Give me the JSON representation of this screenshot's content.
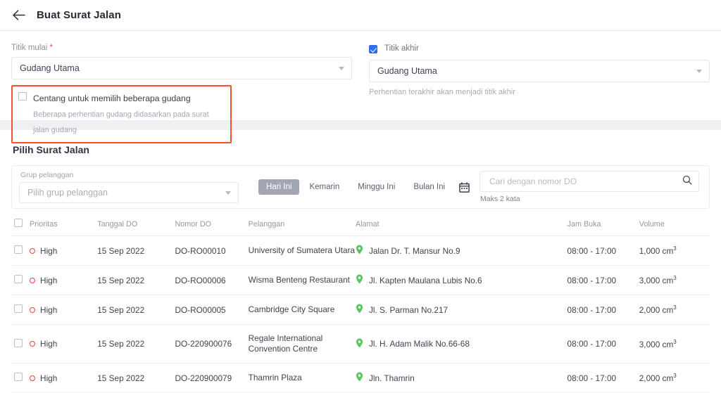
{
  "header": {
    "back_icon": "arrow-left-icon",
    "title": "Buat Surat Jalan"
  },
  "form": {
    "start_point": {
      "label": "Titik mulai",
      "required_mark": "*",
      "value": "Gudang Utama"
    },
    "multi_warehouse": {
      "checked": false,
      "title": "Centang untuk memilih beberapa gudang",
      "subtitle": "Beberapa perhentian gudang didasarkan pada surat jalan gudang",
      "highlight_color": "#f4522d"
    },
    "end_point": {
      "checkbox_checked": true,
      "checkbox_color": "#2f6fed",
      "label": "Titik akhir",
      "value": "Gudang Utama",
      "hint": "Perhentian terakhir akan menjadi titik akhir"
    }
  },
  "main": {
    "section_title": "Pilih Surat Jalan",
    "filters": {
      "customer_group": {
        "label": "Grup pelanggan",
        "placeholder": "Pilih grup pelanggan"
      },
      "ranges": [
        {
          "label": "Hari Ini",
          "active": true
        },
        {
          "label": "Kemarin",
          "active": false
        },
        {
          "label": "Minggu Ini",
          "active": false
        },
        {
          "label": "Bulan Ini",
          "active": false
        }
      ],
      "calendar_icon": "calendar-icon",
      "active_pill_color": "#a2a6b4",
      "search": {
        "placeholder": "Cari dengan nomor DO",
        "value": "",
        "icon": "search-icon",
        "hint": "Maks 2 kata"
      }
    },
    "table": {
      "columns": [
        "",
        "Prioritas",
        "Tanggal DO",
        "Nomor DO",
        "Pelanggan",
        "Alamat",
        "Jam Buka",
        "Volume"
      ],
      "priority_color": "#ed3f3f",
      "pin_color": "#5cc45f",
      "rows": [
        {
          "selected": false,
          "priority": "High",
          "date": "15 Sep 2022",
          "do_number": "DO-RO00010",
          "customer": "University of Sumatera Utara",
          "address": "Jalan Dr. T. Mansur No.9",
          "hours": "08:00 - 17:00",
          "volume": "1,000 cm",
          "volume_exp": "3"
        },
        {
          "selected": false,
          "priority": "High",
          "date": "15 Sep 2022",
          "do_number": "DO-RO00006",
          "customer": "Wisma Benteng Restaurant",
          "address": "Jl. Kapten Maulana Lubis No.6",
          "hours": "08:00 - 17:00",
          "volume": "3,000 cm",
          "volume_exp": "3"
        },
        {
          "selected": false,
          "priority": "High",
          "date": "15 Sep 2022",
          "do_number": "DO-RO00005",
          "customer": "Cambridge City Square",
          "address": "Jl. S. Parman No.217",
          "hours": "08:00 - 17:00",
          "volume": "2,000 cm",
          "volume_exp": "3"
        },
        {
          "selected": false,
          "priority": "High",
          "date": "15 Sep 2022",
          "do_number": "DO-220900076",
          "customer": "Regale International Convention Centre",
          "address": "Jl. H. Adam Malik No.66-68",
          "hours": "08:00 - 17:00",
          "volume": "3,000 cm",
          "volume_exp": "3"
        },
        {
          "selected": false,
          "priority": "High",
          "date": "15 Sep 2022",
          "do_number": "DO-220900079",
          "customer": "Thamrin Plaza",
          "address": "Jln. Thamrin",
          "hours": "08:00 - 17:00",
          "volume": "2,000 cm",
          "volume_exp": "3"
        }
      ]
    }
  }
}
